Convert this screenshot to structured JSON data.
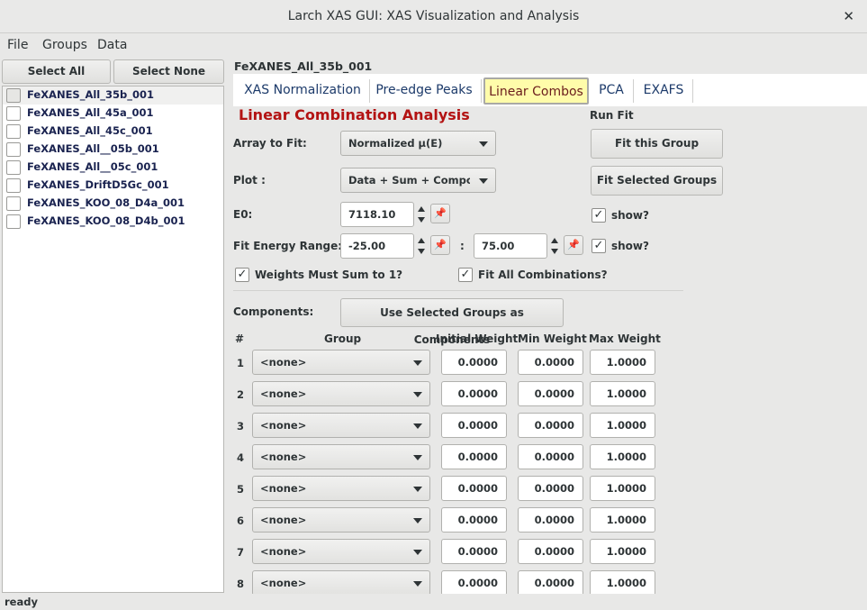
{
  "window": {
    "title": "Larch XAS GUI: XAS Visualization and Analysis",
    "close_glyph": "✕"
  },
  "menu": [
    "File",
    "Groups",
    "Data"
  ],
  "left": {
    "select_all": "Select All",
    "select_none": "Select None",
    "groups": [
      "FeXANES_All_35b_001",
      "FeXANES_All_45a_001",
      "FeXANES_All_45c_001",
      "FeXANES_All__05b_001",
      "FeXANES_All__05c_001",
      "FeXANES_DriftD5Gc_001",
      "FeXANES_KOO_08_D4a_001",
      "FeXANES_KOO_08_D4b_001"
    ]
  },
  "current_group": "FeXANES_All_35b_001",
  "tabs": [
    "XAS Normalization",
    "Pre-edge Peaks",
    "Linear Combos",
    "PCA",
    "EXAFS"
  ],
  "active_tab": "Linear Combos",
  "lca": {
    "heading": "Linear Combination Analysis",
    "array_label": "Array to Fit:",
    "array_value": "Normalized μ(E)",
    "plot_label": "Plot :",
    "plot_value": "Data + Sum + Components",
    "e0_label": "E0:",
    "e0_value": "7118.10",
    "range_label": "Fit Energy Range:",
    "range_min": "-25.00",
    "range_colon": ":",
    "range_max": "75.00",
    "weights_sum_label": "Weights Must Sum to 1?",
    "fit_all_label": "Fit All Combinations?",
    "run_fit_label": "Run Fit",
    "fit_this_group": "Fit this Group",
    "fit_selected_groups": "Fit Selected Groups",
    "show_label": "show?",
    "components_label": "Components:",
    "use_selected": "Use Selected Groups as Components",
    "table_headers": {
      "num": "#",
      "group": "Group",
      "initial": "Initial Weight",
      "min": "Min Weight",
      "max": "Max Weight"
    },
    "rows": [
      {
        "n": "1",
        "group": "<none>",
        "initial": "0.0000",
        "min": "0.0000",
        "max": "1.0000"
      },
      {
        "n": "2",
        "group": "<none>",
        "initial": "0.0000",
        "min": "0.0000",
        "max": "1.0000"
      },
      {
        "n": "3",
        "group": "<none>",
        "initial": "0.0000",
        "min": "0.0000",
        "max": "1.0000"
      },
      {
        "n": "4",
        "group": "<none>",
        "initial": "0.0000",
        "min": "0.0000",
        "max": "1.0000"
      },
      {
        "n": "5",
        "group": "<none>",
        "initial": "0.0000",
        "min": "0.0000",
        "max": "1.0000"
      },
      {
        "n": "6",
        "group": "<none>",
        "initial": "0.0000",
        "min": "0.0000",
        "max": "1.0000"
      },
      {
        "n": "7",
        "group": "<none>",
        "initial": "0.0000",
        "min": "0.0000",
        "max": "1.0000"
      },
      {
        "n": "8",
        "group": "<none>",
        "initial": "0.0000",
        "min": "0.0000",
        "max": "1.0000"
      }
    ]
  },
  "status": "ready",
  "colors": {
    "heading": "#b31313",
    "active_tab_bg": "#fffcaa",
    "group_text": "#1a2350"
  }
}
